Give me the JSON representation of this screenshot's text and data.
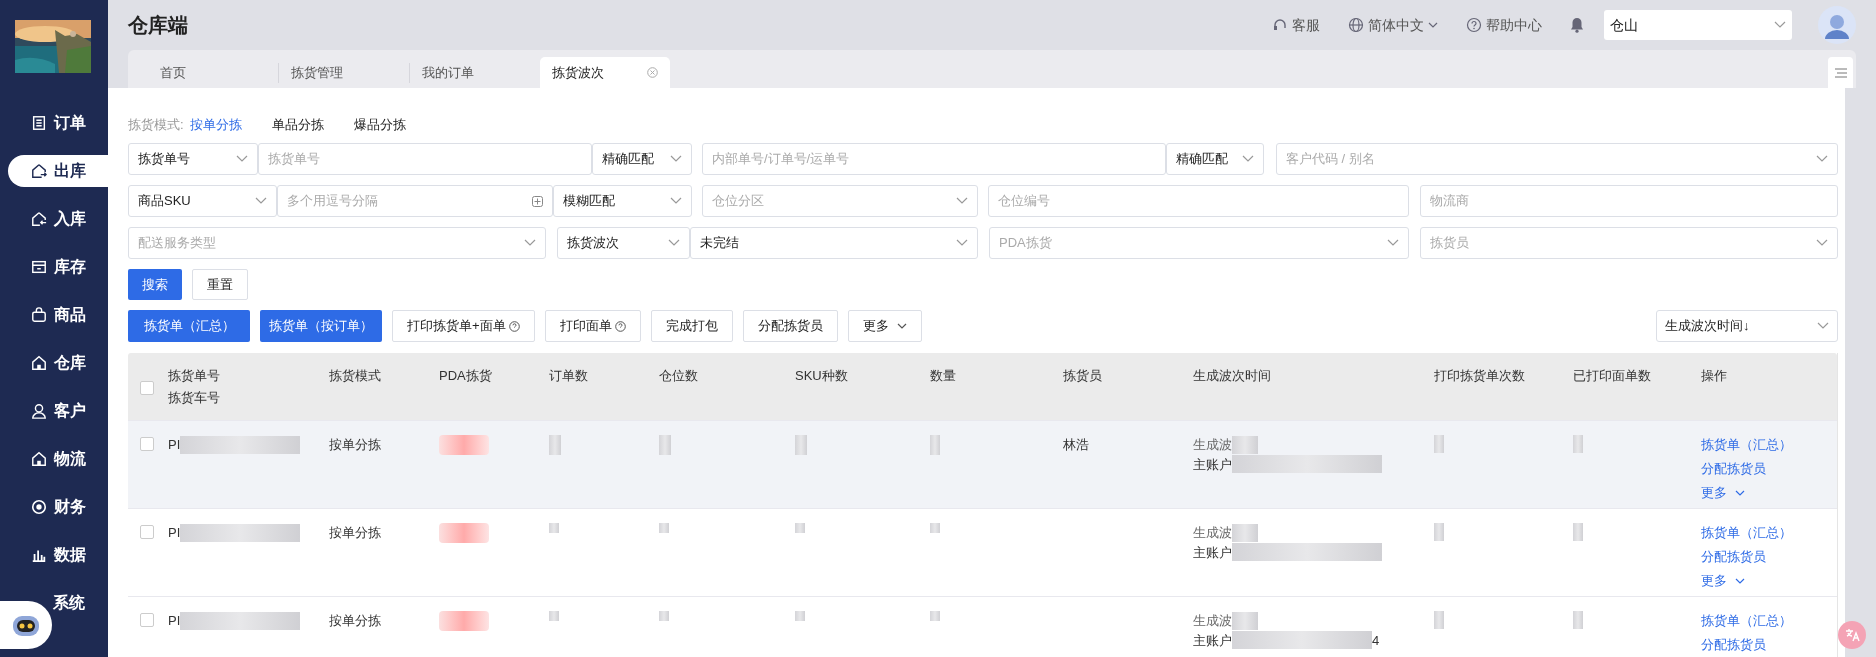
{
  "app_title": "仓库端",
  "header": {
    "service": "客服",
    "language": "简体中文",
    "help": "帮助中心",
    "warehouse": "仓山"
  },
  "sidebar": {
    "items": [
      {
        "label": "订单",
        "selected": false
      },
      {
        "label": "出库",
        "selected": true
      },
      {
        "label": "入库",
        "selected": false
      },
      {
        "label": "库存",
        "selected": false
      },
      {
        "label": "商品",
        "selected": false
      },
      {
        "label": "仓库",
        "selected": false
      },
      {
        "label": "客户",
        "selected": false
      },
      {
        "label": "物流",
        "selected": false
      },
      {
        "label": "财务",
        "selected": false
      },
      {
        "label": "数据",
        "selected": false
      },
      {
        "label": "系统",
        "selected": false
      }
    ]
  },
  "tabs": [
    {
      "label": "首页",
      "selected": false
    },
    {
      "label": "拣货管理",
      "selected": false
    },
    {
      "label": "我的订单",
      "selected": false
    },
    {
      "label": "拣货波次",
      "selected": true
    }
  ],
  "mode": {
    "label": "拣货模式:",
    "options": [
      {
        "label": "按单分拣",
        "selected": true
      },
      {
        "label": "单品分拣",
        "selected": false
      },
      {
        "label": "爆品分拣",
        "selected": false
      }
    ]
  },
  "filters": [
    [
      {
        "kind": "select",
        "value": "拣货单号"
      },
      {
        "kind": "input",
        "placeholder": "拣货单号"
      },
      {
        "kind": "select",
        "value": "精确匹配"
      },
      {
        "kind": "input",
        "placeholder": "内部单号/订单号/运单号"
      },
      {
        "kind": "select",
        "value": "精确匹配"
      },
      {
        "kind": "select",
        "placeholder": "客户代码 / 别名"
      }
    ],
    [
      {
        "kind": "select",
        "value": "商品SKU"
      },
      {
        "kind": "multi",
        "placeholder": "多个用逗号分隔"
      },
      {
        "kind": "select",
        "value": "模糊匹配"
      },
      {
        "kind": "select",
        "placeholder": "仓位分区"
      },
      {
        "kind": "input",
        "placeholder": "仓位编号"
      },
      {
        "kind": "input",
        "placeholder": "物流商"
      }
    ],
    [
      {
        "kind": "select",
        "placeholder": "配送服务类型"
      },
      {
        "kind": "select",
        "value": "拣货波次"
      },
      {
        "kind": "select",
        "value": "未完结"
      },
      {
        "kind": "select",
        "placeholder": "PDA拣货"
      },
      {
        "kind": "select",
        "placeholder": "拣货员"
      }
    ]
  ],
  "search_buttons": [
    {
      "label": "搜索",
      "kind": "primary"
    },
    {
      "label": "重置",
      "kind": "plain"
    }
  ],
  "actions": [
    {
      "label": "拣货单（汇总）",
      "kind": "primary"
    },
    {
      "label": "拣货单（按订单）",
      "kind": "primary"
    },
    {
      "label": "打印拣货单+面单",
      "kind": "help"
    },
    {
      "label": "打印面单",
      "kind": "help"
    },
    {
      "label": "完成打包",
      "kind": "plain"
    },
    {
      "label": "分配拣货员",
      "kind": "plain"
    },
    {
      "label": "更多",
      "kind": "dropdown"
    }
  ],
  "sort": "生成波次时间↓",
  "table": {
    "all_checked": false,
    "columns": [
      [
        "拣货单号",
        "拣货车号"
      ],
      [
        "拣货模式"
      ],
      [
        "PDA拣货"
      ],
      [
        "订单数"
      ],
      [
        "仓位数"
      ],
      [
        "SKU种数"
      ],
      [
        "数量"
      ],
      [
        "拣货员"
      ],
      [
        "生成波次时间"
      ],
      [
        "打印拣货单次数"
      ],
      [
        "已打印面单数"
      ],
      [
        "操作"
      ]
    ],
    "rows": [
      {
        "checked": false,
        "code": "PI",
        "mode": "按单分拣",
        "picker": "林浩",
        "time_label": "生成波",
        "account_label": "主账户",
        "account_tail": "",
        "actions": [
          "拣货单（汇总）",
          "分配拣货员",
          "更多"
        ],
        "hovered": true
      },
      {
        "checked": false,
        "code": "PI",
        "mode": "按单分拣",
        "picker": "",
        "time_label": "生成波",
        "account_label": "主账户",
        "account_tail": "",
        "actions": [
          "拣货单（汇总）",
          "分配拣货员",
          "更多"
        ],
        "hovered": false
      },
      {
        "checked": false,
        "code": "PI",
        "mode": "按单分拣",
        "picker": "",
        "time_label": "生成波",
        "account_label": "主账户",
        "account_tail": "4",
        "actions": [
          "拣货单（汇总）",
          "分配拣货员"
        ],
        "hovered": false
      }
    ]
  }
}
